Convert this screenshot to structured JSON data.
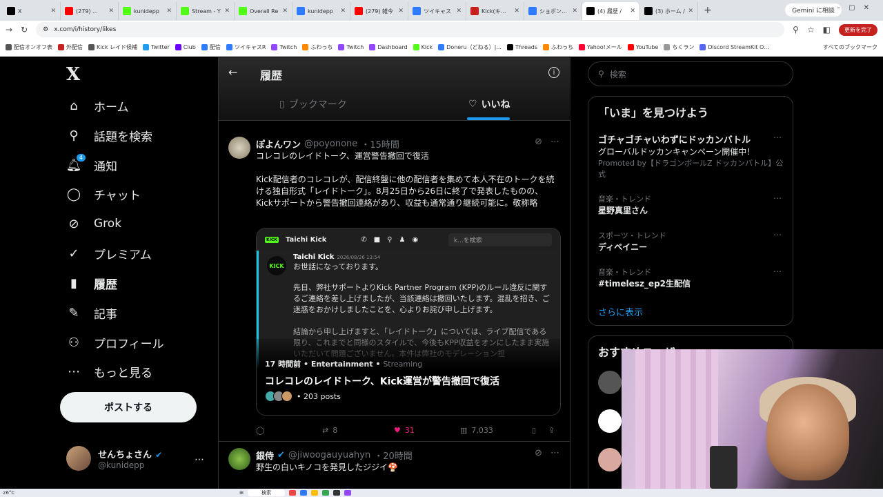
{
  "browser": {
    "tabs": [
      {
        "title": "X",
        "color": "#000000",
        "icon": "x-icon"
      },
      {
        "title": "(279) ...",
        "color": "#ff0000",
        "icon": "youtube-icon"
      },
      {
        "title": "kunidepp",
        "color": "#53fc18",
        "icon": "kick-icon"
      },
      {
        "title": "Stream - Y",
        "color": "#53fc18",
        "icon": "kick-icon"
      },
      {
        "title": "Overall Re",
        "color": "#53fc18",
        "icon": "kick-icon"
      },
      {
        "title": "kunidepp",
        "color": "#2f7bff",
        "icon": "globe-icon"
      },
      {
        "title": "(279) 雑今",
        "color": "#ff0000",
        "icon": "youtube-icon"
      },
      {
        "title": "ツイキャス",
        "color": "#2f7bff",
        "icon": "twitcasting-icon"
      },
      {
        "title": "Kick(キック",
        "color": "#c5221f",
        "icon": "kick-icon"
      },
      {
        "title": "ショボンKICK",
        "color": "#2f7bff",
        "icon": "globe-icon"
      },
      {
        "title": "(4) 履歴 /",
        "color": "#000000",
        "icon": "x-icon",
        "active": true
      },
      {
        "title": "(3) ホーム /",
        "color": "#000000",
        "icon": "x-icon"
      }
    ],
    "gemini_label": "Gemini に相談",
    "url": "x.com/i/history/likes",
    "update_label": "更新を完了",
    "bookmarks": [
      {
        "label": "配信オンオフ表",
        "color": "#555555"
      },
      {
        "label": "外配信",
        "color": "#c5221f"
      },
      {
        "label": "Kick レイド候補",
        "color": "#555555"
      },
      {
        "label": "Twitter",
        "color": "#1d9bf0"
      },
      {
        "label": "Club",
        "color": "#6a00ff"
      },
      {
        "label": "配信",
        "color": "#2f7bff"
      },
      {
        "label": "ツイキャスR",
        "color": "#2f7bff"
      },
      {
        "label": "Twitch",
        "color": "#9146ff"
      },
      {
        "label": "ふわっち",
        "color": "#ff8800"
      },
      {
        "label": "Twitch",
        "color": "#9146ff"
      },
      {
        "label": "Dashboard",
        "color": "#9146ff"
      },
      {
        "label": "Kick",
        "color": "#53fc18"
      },
      {
        "label": "Doneru（どねる）|...",
        "color": "#2f7bff"
      },
      {
        "label": "Threads",
        "color": "#000000"
      },
      {
        "label": "ふわっち",
        "color": "#ff8800"
      },
      {
        "label": "Yahoo!メール",
        "color": "#ff0033"
      },
      {
        "label": "YouTube",
        "color": "#ff0000"
      },
      {
        "label": "ちくラン",
        "color": "#999999"
      },
      {
        "label": "Discord StreamKit O...",
        "color": "#5865f2"
      }
    ],
    "bookmarks_all": "すべてのブックマーク"
  },
  "nav": {
    "items": [
      {
        "label": "ホーム",
        "icon": "home-icon",
        "glyph": "⌂"
      },
      {
        "label": "話題を検索",
        "icon": "search-icon",
        "glyph": "⚲"
      },
      {
        "label": "通知",
        "icon": "bell-icon",
        "glyph": "🔔︎",
        "badge": "4"
      },
      {
        "label": "チャット",
        "icon": "chat-icon",
        "glyph": "◯"
      },
      {
        "label": "Grok",
        "icon": "grok-icon",
        "glyph": "⊘"
      },
      {
        "label": "プレミアム",
        "icon": "premium-icon",
        "glyph": "✓"
      },
      {
        "label": "履歴",
        "icon": "bookmark-icon",
        "glyph": "▮",
        "bold": true
      },
      {
        "label": "記事",
        "icon": "article-icon",
        "glyph": "✎"
      },
      {
        "label": "プロフィール",
        "icon": "profile-icon",
        "glyph": "⚇"
      },
      {
        "label": "もっと見る",
        "icon": "more-icon",
        "glyph": "⋯"
      }
    ],
    "post_label": "ポストする",
    "account": {
      "name": "せんちょさん",
      "handle": "@kunidepp"
    }
  },
  "main": {
    "title": "履歴",
    "tabs": {
      "bookmark": "ブックマーク",
      "likes": "いいね"
    },
    "tweet1": {
      "name": "ぽよんワン",
      "handle": "@poyonone",
      "time": "・15時間",
      "line1": "コレコレのレイドトーク、運営警告撤回で復活",
      "body": "Kick配信者のコレコレが、配信終盤に他の配信者を集めて本人不在のトークを続ける独自形式「レイドトーク」。8月25日から26日に終了で発表したものの、Kickサポートから警告撤回連絡があり、収益も通常通り継続可能に。敬称略",
      "card": {
        "channel": "Taichi Kick",
        "search_placeholder": "k...を検索",
        "sender": "Taichi Kick",
        "sender_time": "2026/08/26 13:54",
        "logo": "KICK",
        "msg1": "お世話になっております。",
        "msg2": "先日、弊社サポートよりKick Partner Program (KPP)のルール違反に関するご連絡を差し上げましたが、当該連絡は撤回いたします。混乱を招き、ご迷惑をおかけしましたことを、心よりお詫び申し上げます。",
        "msg3": "結論から申し上げますと、「レイドトーク」については、ライブ配信である限り、これまでと同様のスタイルで、今後もKPP収益をオンにしたまま実施いただいて問題ございません。本件は弊社のモデレーション担",
        "meta": "17 時間前 • Entertainment • ",
        "meta_cat": "Streaming",
        "title": "コレコレのレイドトーク、Kick運営が警告撤回で復活",
        "posts": "• 203 posts"
      },
      "actions": {
        "reply": "",
        "retweet": "8",
        "like": "31",
        "views": "7,033"
      }
    },
    "tweet2": {
      "name": "銀侍",
      "handle": "@jiwoogauyuahyn",
      "time": "・20時間",
      "body": "野生の白いキノコを発見したジジイ🍄"
    }
  },
  "right": {
    "search_placeholder": "検索",
    "trends_title": "「いま」を見つけよう",
    "trends": [
      {
        "cat": "",
        "title": "ゴチャゴチャいわずにドッカンバトル",
        "sub": "グローバルドッカンキャンペーン開催中！",
        "promo": "Promoted by【ドラゴンボールZ ドッカンバトル】公式"
      },
      {
        "cat": "音楽・トレンド",
        "title": "星野真里さん"
      },
      {
        "cat": "スポーツ・トレンド",
        "title": "ディベイニー"
      },
      {
        "cat": "音楽・トレンド",
        "title": "#timelesz_ep2生配信"
      }
    ],
    "show_more": "さらに表示",
    "recs_title": "おすすめユーザー"
  },
  "taskbar": {
    "weather": "26°C",
    "search": "検索"
  },
  "colors": {
    "accent": "#1d9bf0",
    "like": "#f91880"
  }
}
